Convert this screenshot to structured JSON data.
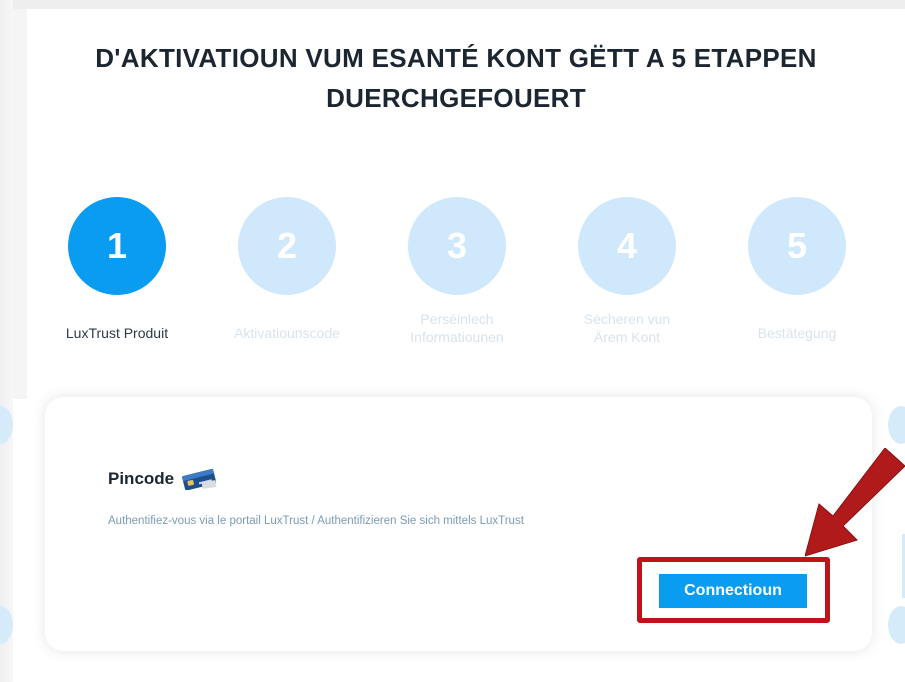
{
  "page": {
    "title": "D'AKTIVATIOUN VUM ESANTÉ KONT GËTT A 5 ETAPPEN DUERCHGEFOUERT"
  },
  "steps": [
    {
      "number": "1",
      "label": "LuxTrust Produit",
      "active": true
    },
    {
      "number": "2",
      "label": "Aktivatiounscode",
      "active": false
    },
    {
      "number": "3",
      "label": "Perséinlech Informatiounen",
      "active": false
    },
    {
      "number": "4",
      "label": "Sécheren vun Ärem Kont",
      "active": false
    },
    {
      "number": "5",
      "label": "Bestätegung",
      "active": false
    }
  ],
  "card": {
    "title": "Pincode",
    "description": "Authentifiez-vous via le portail LuxTrust / Authentifizieren Sie sich mittels LuxTrust",
    "button_label": "Connectioun",
    "icon": "smart-card-icon"
  },
  "colors": {
    "accent": "#0a9cf0",
    "inactive_step": "#cfe8fb",
    "highlight": "#c0121a",
    "title": "#1b2631"
  },
  "annotations": {
    "arrow_icon": "red-arrow-icon"
  }
}
